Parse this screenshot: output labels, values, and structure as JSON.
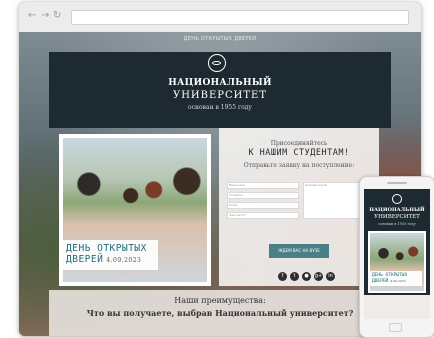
{
  "browser": {
    "nav": {
      "back": "←",
      "forward": "→",
      "reload": "↻"
    },
    "url": ""
  },
  "site": {
    "topline": "ДЕНЬ ОТКРЫТЫХ ДВЕРЕЙ",
    "header": {
      "title": "НАЦИОНАЛЬНЫЙ",
      "subtitle": "УНИВЕРСИТЕТ",
      "founded": "основан в 1955 году"
    },
    "event": {
      "line1": "ДЕНЬ ОТКРЫТЫХ",
      "line2": "ДВЕРЕЙ",
      "date": "4.09.2023"
    },
    "form": {
      "join": "Присоединяйтесь",
      "headline": "К НАШИМ СТУДЕНТАМ!",
      "prompt": "Отправьте заявку на поступление:",
      "fields": {
        "f1": "Ваше имя",
        "f2": "Телефон",
        "f3": "Email",
        "f4": "Факультет",
        "f5": "Комментарий"
      },
      "submit": "ЖДЕМ ВАС НА ВУЗЕ",
      "social": [
        "f",
        "t",
        "●",
        "g+",
        "in"
      ]
    },
    "benefits": {
      "heading": "Наши преимущества:",
      "question": "Что вы получаете, выбрав Национальный университет?"
    }
  },
  "phone": {
    "title": "НАЦИОНАЛЬНЫЙ",
    "subtitle": "УНИВЕРСИТЕТ",
    "founded": "основан в 1955 году",
    "event_line1": "ДЕНЬ ОТКРЫТЫХ",
    "event_line2": "ДВЕРЕЙ",
    "date": "4.09.2023"
  },
  "colors": {
    "hero_bg": "#1d2a31",
    "accent": "#1f6f7a",
    "button": "#4b7f88"
  }
}
